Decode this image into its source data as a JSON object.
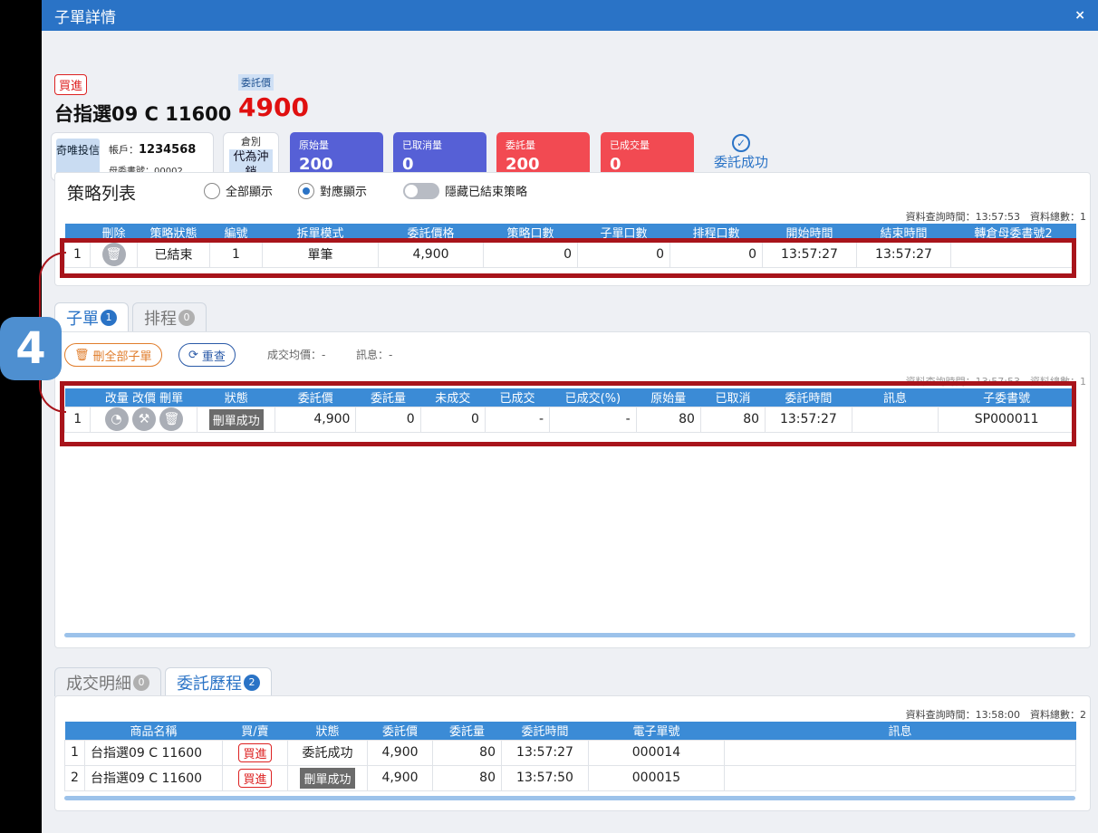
{
  "title": "子單詳情",
  "close": "×",
  "header": {
    "side": "買進",
    "instrument": "台指選09 C 11600",
    "price_label": "委託價",
    "price": "4900",
    "account_type": "奇唯投信",
    "account_label": "帳戶：",
    "account_no": "1234568",
    "parent_order_label": "母委書號：00002",
    "order_category_label": "倉別",
    "order_category_value": "代為沖銷",
    "stats": [
      {
        "label": "原始量",
        "value": "200"
      },
      {
        "label": "已取消量",
        "value": "0"
      },
      {
        "label": "委託量",
        "value": "200"
      },
      {
        "label": "已成交量",
        "value": "0"
      }
    ],
    "status": "委託成功"
  },
  "strategy": {
    "title": "策略列表",
    "radio_all": "全部顯示",
    "radio_match": "對應顯示",
    "toggle_label": "隱藏已結束策略",
    "meta": "資料查詢時間：13:57:53　資料總數：1",
    "columns": [
      "",
      "刪除",
      "策略狀態",
      "編號",
      "拆單模式",
      "委託價格",
      "策略口數",
      "子單口數",
      "排程口數",
      "開始時間",
      "結束時間",
      "轉倉母委書號2"
    ],
    "row": {
      "idx": "1",
      "status": "已結束",
      "no": "1",
      "mode": "單筆",
      "price": "4,900",
      "qty": "0",
      "sub_qty": "0",
      "sched_qty": "0",
      "start": "13:57:27",
      "end": "13:57:27",
      "ref": ""
    }
  },
  "sub_tabs": [
    {
      "label": "子單",
      "count": "1"
    },
    {
      "label": "排程",
      "count": "0"
    }
  ],
  "suborders": {
    "delete_all": "刪全部子單",
    "refresh": "重查",
    "avg_price": "成交均價：-",
    "message": "訊息：-",
    "meta": "資料查詢時間：13:57:53　資料總數：1",
    "columns": [
      "",
      "改量 改價 刪單",
      "狀態",
      "委託價",
      "委託量",
      "未成交",
      "已成交",
      "已成交(%)",
      "原始量",
      "已取消",
      "委託時間",
      "訊息",
      "子委書號"
    ],
    "row": {
      "idx": "1",
      "status": "刪單成功",
      "price": "4,900",
      "qty": "0",
      "unfilled": "0",
      "filled": "-",
      "filled_pct": "-",
      "orig": "80",
      "cancelled": "80",
      "time": "13:57:27",
      "msg": "",
      "sub_no": "SP000011"
    }
  },
  "hist_tabs": [
    {
      "label": "成交明細",
      "count": "0"
    },
    {
      "label": "委託歷程",
      "count": "2"
    }
  ],
  "history": {
    "meta": "資料查詢時間：13:58:00　資料總數：2",
    "columns": [
      "",
      "商品名稱",
      "買/賣",
      "狀態",
      "委託價",
      "委託量",
      "委託時間",
      "電子單號",
      "訊息"
    ],
    "rows": [
      {
        "idx": "1",
        "name": "台指選09 C 11600",
        "side": "買進",
        "status": "委託成功",
        "price": "4,900",
        "qty": "80",
        "time": "13:57:27",
        "eno": "000014",
        "msg": ""
      },
      {
        "idx": "2",
        "name": "台指選09 C 11600",
        "side": "買進",
        "status": "刪單成功",
        "price": "4,900",
        "qty": "80",
        "time": "13:57:50",
        "eno": "000015",
        "msg": ""
      }
    ]
  },
  "step_badge": "4"
}
